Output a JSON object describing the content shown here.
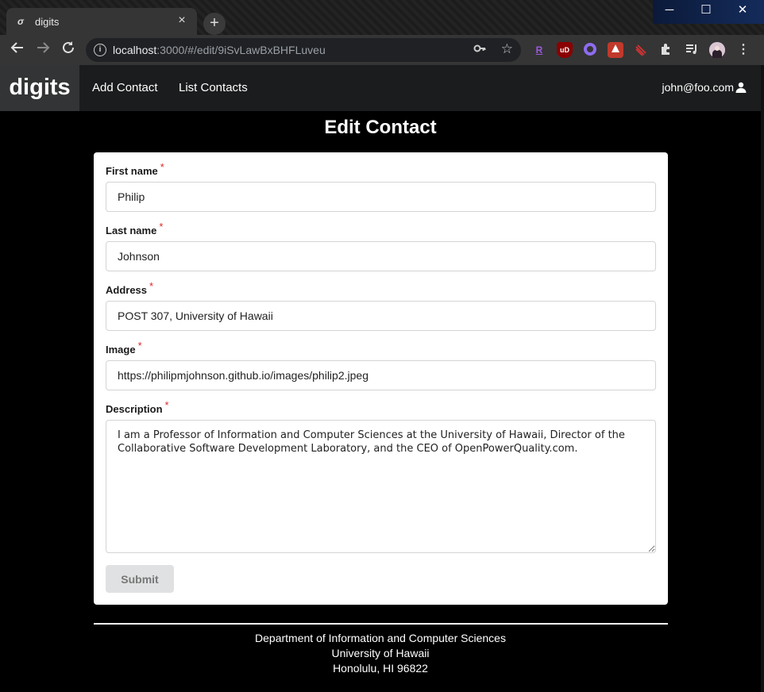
{
  "browser": {
    "tab_title": "digits",
    "tab_close": "×",
    "new_tab": "+",
    "url_host": "localhost",
    "url_path": ":3000/#/edit/9iSvLawBxBHFLuveu",
    "window_controls": {
      "minimize": "─",
      "maximize": "☐",
      "close": "✕"
    },
    "extensions": [
      "R",
      "uD"
    ]
  },
  "navbar": {
    "brand": "digits",
    "links": [
      "Add Contact",
      "List Contacts"
    ],
    "user": "john@foo.com"
  },
  "form": {
    "title": "Edit Contact",
    "required_marker": "*",
    "fields": {
      "first_name": {
        "label": "First name",
        "value": "Philip"
      },
      "last_name": {
        "label": "Last name",
        "value": "Johnson"
      },
      "address": {
        "label": "Address",
        "value": "POST 307, University of Hawaii"
      },
      "image": {
        "label": "Image",
        "value": "https://philipmjohnson.github.io/images/philip2.jpeg"
      },
      "description": {
        "label": "Description",
        "value": "I am a Professor of Information and Computer Sciences at the University of Hawaii, Director of the Collaborative Software Development Laboratory, and the CEO of OpenPowerQuality.com."
      }
    },
    "submit_label": "Submit"
  },
  "footer": {
    "line1": "Department of Information and Computer Sciences",
    "line2": "University of Hawaii",
    "line3": "Honolulu, HI 96822"
  },
  "colors": {
    "navbar": "#1b1c1d",
    "brand_bg": "#333435",
    "required": "#db2828",
    "submit_bg": "#e0e1e2"
  }
}
